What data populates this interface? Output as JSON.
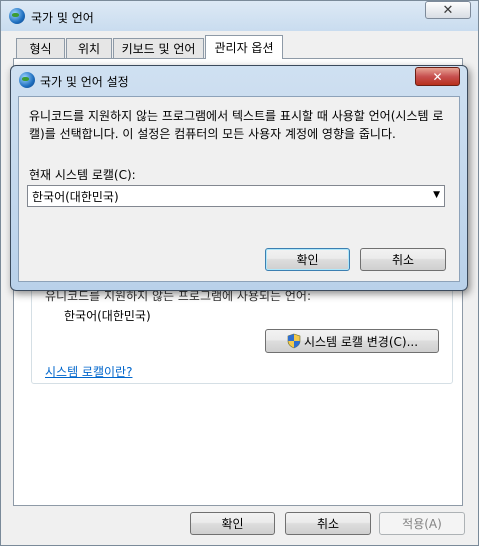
{
  "outer": {
    "title": "국가 및 언어",
    "close": "✕",
    "tabs": [
      "형식",
      "위치",
      "키보드 및 언어",
      "관리자 옵션"
    ],
    "hidden_text": "유니코드를 지원하지 않는 프로그램에 사용되는 언어:",
    "current_locale": "한국어(대한민국)",
    "change_locale_button": "시스템 로캘 변경(C)...",
    "link": "시스템 로캘이란?",
    "buttons": {
      "ok": "확인",
      "cancel": "취소",
      "apply": "적용(A)"
    }
  },
  "dialog": {
    "title": "국가 및 언어 설정",
    "close": "✕",
    "description": "유니코드를 지원하지 않는 프로그램에서 텍스트를 표시할 때 사용할 언어(시스템 로캘)를 선택합니다. 이 설정은 컴퓨터의 모든 사용자 계정에 영향을 줍니다.",
    "label": "현재 시스템 로캘(C):",
    "selected_value": "한국어(대한민국)",
    "dropdown_arrow": "▼",
    "ok": "확인",
    "cancel": "취소"
  },
  "icons": {
    "globe": "globe-icon",
    "shield": "uac-shield-icon"
  }
}
